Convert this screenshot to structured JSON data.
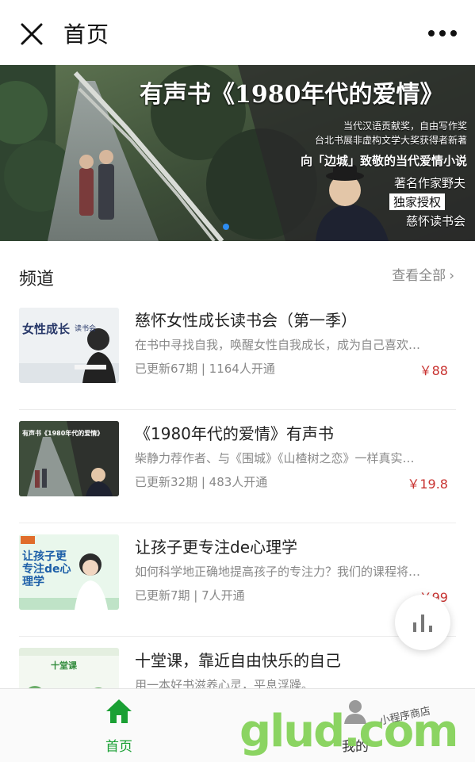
{
  "header": {
    "title": "首页",
    "close_icon": "close-icon",
    "more_icon": "more-dots-icon"
  },
  "banner": {
    "title": "有声书《1980年代的爱情》",
    "sub1": "当代汉语贡献奖，自由写作奖",
    "sub2": "台北书展非虚构文学大奖获得者新著",
    "slogan": "向「边城」致敬的当代爱情小说",
    "author": "著名作家野夫",
    "license": "独家授权",
    "brand": "慈怀读书会",
    "pager_color": "#2d8cf0"
  },
  "section": {
    "title": "频道",
    "view_all": "查看全部",
    "chevron": "›"
  },
  "items": [
    {
      "name": "慈怀女性成长读书会（第一季）",
      "desc": "在书中寻找自我，唤醒女性自我成长，成为自己喜欢…",
      "meta": "已更新67期 | 1164人开通",
      "price": "￥88",
      "thumb_title": "女性成长",
      "thumb_tag": "读书会"
    },
    {
      "name": "《1980年代的爱情》有声书",
      "desc": "柴静力荐作者、与《围城》《山楂树之恋》一样真实…",
      "meta": "已更新32期 | 483人开通",
      "price": "￥19.8",
      "thumb_title": "有声书《1980年代的爱情》"
    },
    {
      "name": "让孩子更专注de心理学",
      "desc": "如何科学地正确地提高孩子的专注力？我们的课程将…",
      "meta": "已更新7期 | 7人开通",
      "price": "￥99",
      "thumb_title": "让孩子更专注de心理学"
    },
    {
      "name": "十堂课，靠近自由快乐的自己",
      "desc": "用一本好书滋养心灵，平息浮躁。",
      "meta": "",
      "price": "",
      "thumb_title": "十堂课"
    }
  ],
  "tabs": [
    {
      "label": "首页",
      "icon": "home-icon",
      "active": true
    },
    {
      "label": "我的",
      "icon": "user-icon",
      "active": false
    }
  ],
  "watermark": {
    "main": "glud.com",
    "small": "小程序商店"
  },
  "colors": {
    "accent_green": "#1aa034",
    "price_red": "#c8312f"
  }
}
